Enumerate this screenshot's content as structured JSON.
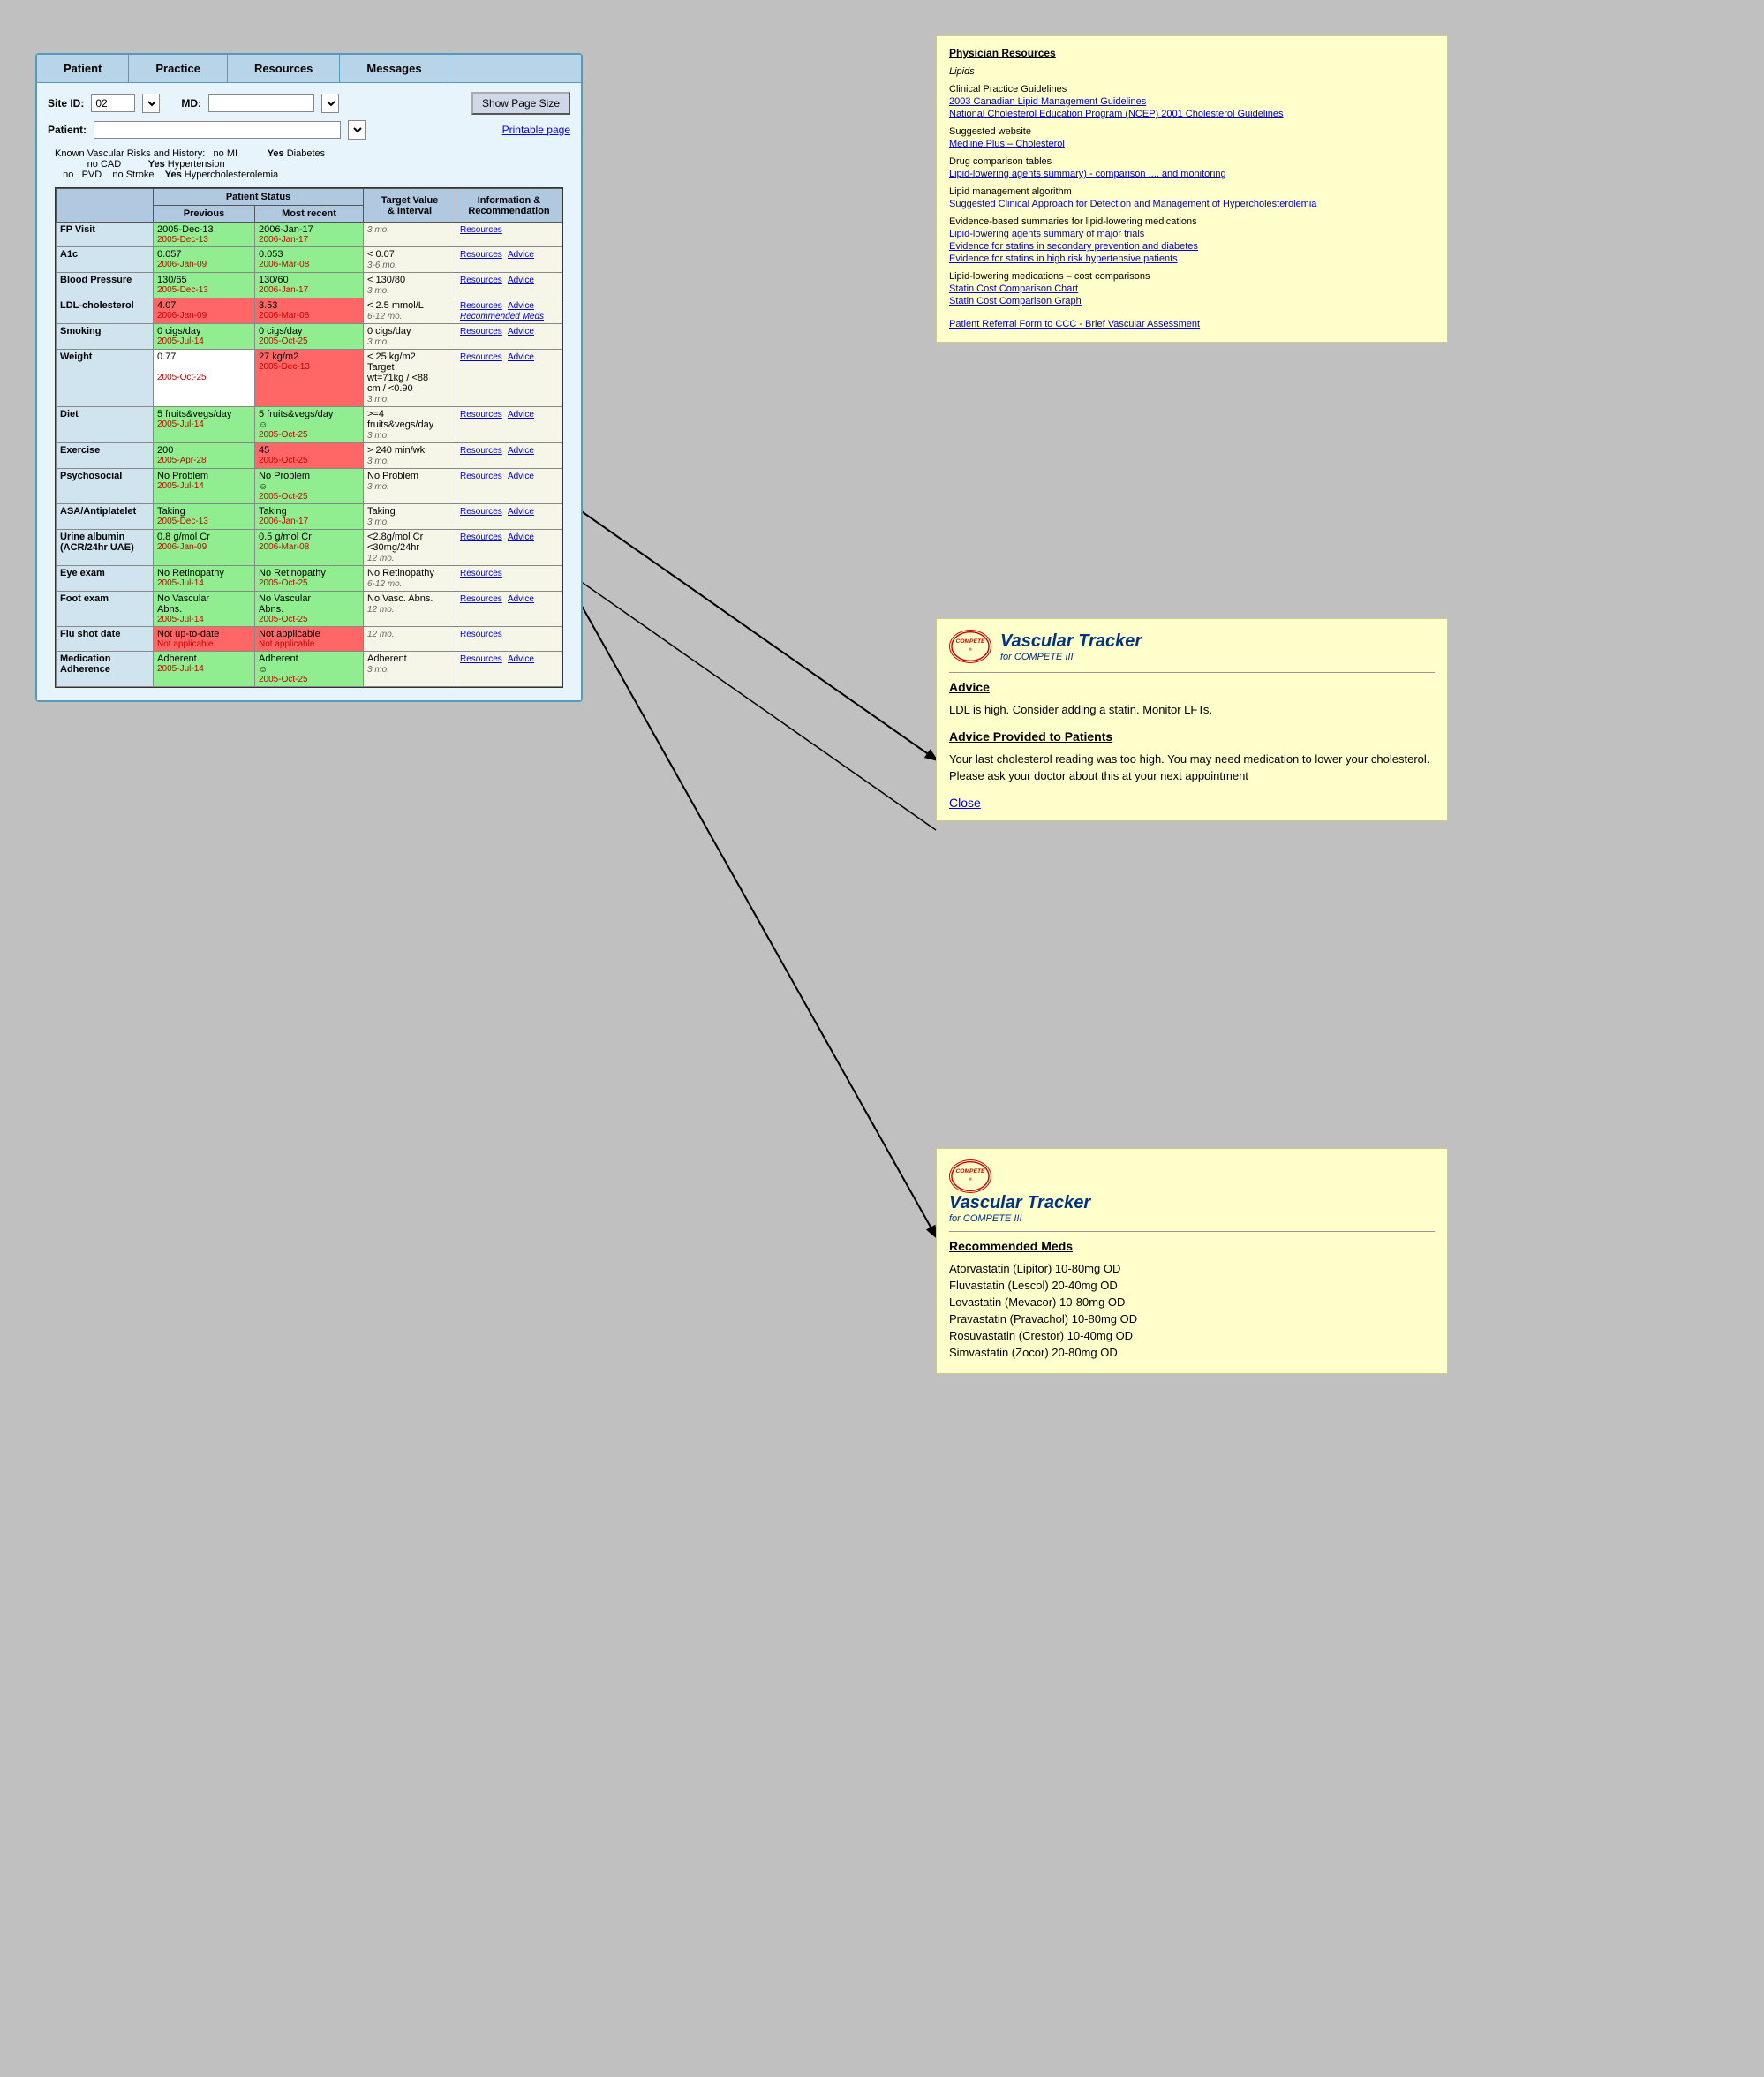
{
  "nav": {
    "items": [
      "Patient",
      "Practice",
      "Resources",
      "Messages"
    ]
  },
  "form": {
    "site_id_label": "Site ID:",
    "site_id_value": "02",
    "md_label": "MD:",
    "show_page_btn": "Show Page Size",
    "printable_link": "Printable page",
    "patient_label": "Patient:"
  },
  "vascular_risks": {
    "label": "Known Vascular Risks and History:",
    "items": [
      {
        "no": "no",
        "condition": "MI"
      },
      {
        "no": "no",
        "condition": "CAD"
      },
      {
        "no": "no",
        "condition": "PVD"
      },
      {
        "no": "no",
        "condition": "Stroke"
      },
      {
        "yes": "Yes",
        "condition": "Diabetes"
      },
      {
        "yes": "Yes",
        "condition": "Hypertension"
      },
      {
        "yes": "Yes",
        "condition": "Hypercholesterolemia"
      }
    ]
  },
  "table": {
    "headers": {
      "col1": "",
      "patient_status": "Patient Status",
      "previous": "Previous",
      "most_recent": "Most recent",
      "target": "Target Value & Interval",
      "info": "Information & Recommendation"
    },
    "rows": [
      {
        "label": "FP Visit",
        "previous": "2005-Dec-13",
        "previous_date": "2005-Dec-13",
        "recent": "2006-Jan-17",
        "recent_date": "2006-Jan-17",
        "target": "",
        "interval": "3 mo.",
        "resources": "Resources",
        "advice": "",
        "prev_color": "green",
        "rec_color": "green"
      },
      {
        "label": "A1c",
        "previous": "0.057",
        "previous_date": "2006-Jan-09",
        "recent": "0.053",
        "recent_date": "2006-Mar-08",
        "target": "< 0.07",
        "interval": "3-6 mo.",
        "resources": "Resources",
        "advice": "Advice",
        "prev_color": "green",
        "rec_color": "green"
      },
      {
        "label": "Blood Pressure",
        "previous": "130/65",
        "previous_date": "2005-Dec-13",
        "recent": "130/60",
        "recent_date": "2006-Jan-17",
        "target": "< 130/80",
        "interval": "3 mo.",
        "resources": "Resources",
        "advice": "Advice",
        "prev_color": "green",
        "rec_color": "green"
      },
      {
        "label": "LDL-cholesterol",
        "previous": "4.07",
        "previous_date": "2006-Jan-09",
        "recent": "3.53",
        "recent_date": "2006-Mar-08",
        "target": "< 2.5 mmol/L",
        "interval": "6-12 mo.",
        "resources": "Resources",
        "advice": "Advice",
        "rec_meds": "Recommended Meds",
        "prev_color": "red",
        "rec_color": "red"
      },
      {
        "label": "Smoking",
        "previous": "0 cigs/day",
        "previous_date": "2005-Jul-14",
        "recent": "0 cigs/day",
        "recent_date": "2005-Oct-25",
        "target": "0 cigs/day",
        "interval": "3 mo.",
        "resources": "Resources",
        "advice": "Advice",
        "prev_color": "green",
        "rec_color": "green"
      },
      {
        "label": "Weight",
        "previous": "0.77",
        "previous_date": "2005-Oct-25",
        "recent": "27 kg/m2",
        "recent_date": "2005-Dec-13",
        "target": "< 25 kg/m2 Target wt=71kg / <88 cm / <0.90",
        "interval": "3 mo.",
        "resources": "Resources",
        "advice": "Advice",
        "prev_color": "white",
        "rec_color": "red"
      },
      {
        "label": "Diet",
        "previous": "5 fruits&vegs/day",
        "previous_date": "2005-Jul-14",
        "recent": "5 fruits&vegs/day",
        "recent_date": "2005-Oct-25",
        "recent_smiley": true,
        "target": ">=4 fruits&vegs/day",
        "interval": "3 mo.",
        "resources": "Resources",
        "advice": "Advice",
        "prev_color": "green",
        "rec_color": "green"
      },
      {
        "label": "Exercise",
        "previous": "200",
        "previous_date": "2005-Apr-28",
        "recent": "45",
        "recent_date": "2005-Oct-25",
        "target": "> 240 min/wk",
        "interval": "3 mo.",
        "resources": "Resources",
        "advice": "Advice",
        "prev_color": "green",
        "rec_color": "red"
      },
      {
        "label": "Psychosocial",
        "previous": "No Problem",
        "previous_date": "2005-Jul-14",
        "recent": "No Problem",
        "recent_date": "2005-Oct-25",
        "recent_smiley": true,
        "target": "No Problem",
        "interval": "3 mo.",
        "resources": "Resources",
        "advice": "Advice",
        "prev_color": "green",
        "rec_color": "green"
      },
      {
        "label": "ASA/Antiplatelet",
        "previous": "Taking",
        "previous_date": "2005-Dec-13",
        "recent": "Taking",
        "recent_date": "2006-Jan-17",
        "target": "Taking",
        "interval": "3 mo.",
        "resources": "Resources",
        "advice": "Advice",
        "prev_color": "green",
        "rec_color": "green"
      },
      {
        "label": "Urine albumin (ACR/24hr UAE)",
        "previous": "0.8 g/mol Cr",
        "previous_date": "2006-Jan-09",
        "recent": "0.5 g/mol Cr",
        "recent_date": "2006-Mar-08",
        "target": "<2.8g/mol Cr <30mg/24hr",
        "interval": "12 mo.",
        "resources": "Resources",
        "advice": "Advice",
        "prev_color": "green",
        "rec_color": "green"
      },
      {
        "label": "Eye exam",
        "previous": "No Retinopathy",
        "previous_date": "2005-Jul-14",
        "recent": "No Retinopathy",
        "recent_date": "2005-Oct-25",
        "target": "No Retinopathy",
        "interval": "6-12 mo.",
        "resources": "Resources",
        "advice": "",
        "prev_color": "green",
        "rec_color": "green"
      },
      {
        "label": "Foot exam",
        "previous": "No Vascular Abns.",
        "previous_date": "2005-Jul-14",
        "recent": "No Vascular Abns.",
        "recent_date": "2005-Oct-25",
        "target": "No Vasc. Abns.",
        "interval": "12 mo.",
        "resources": "Resources",
        "advice": "Advice",
        "prev_color": "green",
        "rec_color": "green"
      },
      {
        "label": "Flu shot date",
        "previous": "Not up-to-date",
        "previous_date": "Not applicable",
        "recent": "Not applicable",
        "recent_date": "Not applicable",
        "target": "",
        "interval": "12 mo.",
        "resources": "Resources",
        "advice": "",
        "prev_color": "red",
        "rec_color": "red"
      },
      {
        "label": "Medication Adherence",
        "previous": "Adherent",
        "previous_date": "2005-Jul-14",
        "recent": "Adherent",
        "recent_date": "2005-Oct-25",
        "recent_smiley": true,
        "target": "Adherent",
        "interval": "3 mo.",
        "resources": "Resources",
        "advice": "Advice",
        "prev_color": "green",
        "rec_color": "green"
      }
    ]
  },
  "physician_resources": {
    "title": "Physician Resources",
    "lipids_label": "Lipids",
    "cpg_label": "Clinical Practice Guidelines",
    "links": [
      "2003 Canadian Lipid Management Guidelines",
      "National Cholesterol Education Program (NCEP) 2001 Cholesterol Guidelines"
    ],
    "suggested_website_label": "Suggested website",
    "medline_link": "Medline Plus – Cholesterol",
    "drug_comparison_label": "Drug comparison tables",
    "drug_links": [
      "Lipid-lowering agents summary) - comparison .... and monitoring"
    ],
    "algorithm_label": "Lipid management algorithm",
    "algorithm_link": "Suggested Clinical Approach for Detection and Management of Hypercholesterolemia",
    "evidence_label": "Evidence-based summaries for lipid-lowering medications",
    "evidence_links": [
      "Lipid-lowering agents summary of major trials",
      "Evidence for statins in secondary prevention and diabetes",
      "Evidence for statins in high risk hypertensive patients"
    ],
    "cost_label": "Lipid-lowering medications – cost comparisons",
    "cost_links": [
      "Statin Cost Comparison Chart",
      "Statin Cost Comparison Graph"
    ],
    "referral_link": "Patient Referral Form to CCC - Brief Vascular Assessment"
  },
  "advice_panel": {
    "tracker_title": "Vascular Tracker",
    "tracker_subtitle": "for COMPETE III",
    "advice_title": "Advice",
    "advice_text": "LDL is high. Consider adding a statin. Monitor LFTs.",
    "provided_title": "Advice Provided to Patients",
    "provided_text": "Your last cholesterol reading was too high. You may need medication to lower your cholesterol. Please ask your doctor about this at your next appointment",
    "close_label": "Close"
  },
  "meds_panel": {
    "tracker_title": "Vascular Tracker",
    "tracker_subtitle": "for COMPETE III",
    "meds_title": "Recommended Meds",
    "meds": [
      "Atorvastatin (Lipitor) 10-80mg OD",
      "Fluvastatin (Lescol) 20-40mg OD",
      "Lovastatin (Mevacor) 10-80mg OD",
      "Pravastatin (Pravachol) 10-80mg OD",
      "Rosuvastatin (Crestor) 10-40mg OD",
      "Simvastatin (Zocor) 20-80mg OD"
    ]
  }
}
